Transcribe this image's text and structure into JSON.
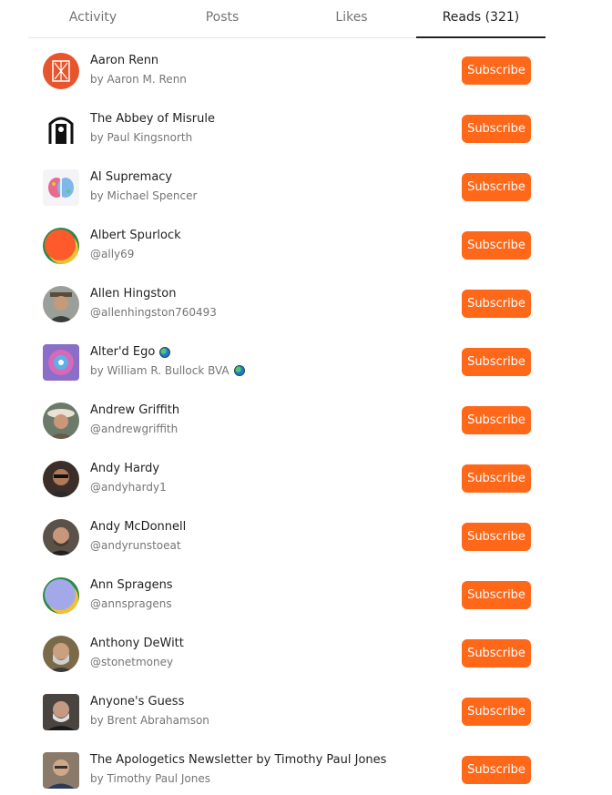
{
  "tabs": [
    {
      "label": "Activity"
    },
    {
      "label": "Posts"
    },
    {
      "label": "Likes"
    },
    {
      "label": "Reads (321)"
    }
  ],
  "active_tab": "Reads (321)",
  "subscribe_label": "Subscribe",
  "accent_color": "#ff6719",
  "subscriptions": [
    {
      "name": "Aaron Renn",
      "sub": "by Aaron M. Renn"
    },
    {
      "name": "The Abbey of Misrule",
      "sub": "by Paul Kingsnorth"
    },
    {
      "name": "AI Supremacy",
      "sub": "by Michael Spencer"
    },
    {
      "name": "Albert Spurlock",
      "sub": "@ally69"
    },
    {
      "name": "Allen Hingston",
      "sub": "@allenhingston760493"
    },
    {
      "name": "Alter'd Ego",
      "sub": "by William R. Bullock BVA"
    },
    {
      "name": "Andrew Griffith",
      "sub": "@andrewgriffith"
    },
    {
      "name": "Andy Hardy",
      "sub": "@andyhardy1"
    },
    {
      "name": "Andy McDonnell",
      "sub": "@andyrunstoeat"
    },
    {
      "name": "Ann Spragens",
      "sub": "@annspragens"
    },
    {
      "name": "Anthony DeWitt",
      "sub": "@stonetmoney"
    },
    {
      "name": "Anyone's Guess",
      "sub": "by Brent Abrahamson"
    },
    {
      "name": "The Apologetics Newsletter by Timothy Paul Jones",
      "sub": "by Timothy Paul Jones"
    }
  ]
}
